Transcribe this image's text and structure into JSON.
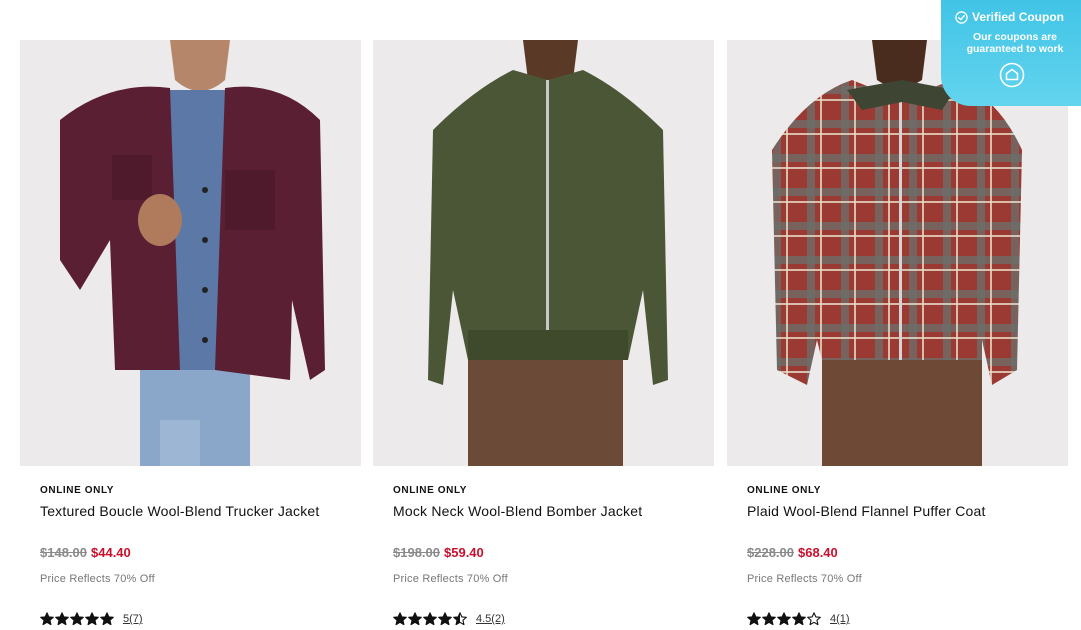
{
  "products": [
    {
      "badge": "ONLINE ONLY",
      "title": "Textured Boucle Wool-Blend Trucker Jacket",
      "price_original": "$148.00",
      "price_sale": "$44.40",
      "price_note": "Price Reflects 70% Off",
      "rating_value": 5,
      "rating_label": "5(7)",
      "jacket_color": "#5a1f33"
    },
    {
      "badge": "ONLINE ONLY",
      "title": "Mock Neck Wool-Blend Bomber Jacket",
      "price_original": "$198.00",
      "price_sale": "$59.40",
      "price_note": "Price Reflects 70% Off",
      "rating_value": 4.5,
      "rating_label": "4.5(2)",
      "jacket_color": "#4b5636"
    },
    {
      "badge": "ONLINE ONLY",
      "title": "Plaid Wool-Blend Flannel Puffer Coat",
      "price_original": "$228.00",
      "price_sale": "$68.40",
      "price_note": "Price Reflects 70% Off",
      "rating_value": 4,
      "rating_label": "4(1)",
      "jacket_color": "#9b3a32"
    }
  ],
  "coupon": {
    "title": "Verified Coupon",
    "body": "Our coupons are guaranteed to work",
    "icon": "check-circle-icon",
    "logo_icon": "coupon-logo-icon"
  },
  "colors": {
    "sale_price": "#c8102e",
    "coupon_bg": "#4ccbea",
    "image_bg": "#eceaea"
  }
}
